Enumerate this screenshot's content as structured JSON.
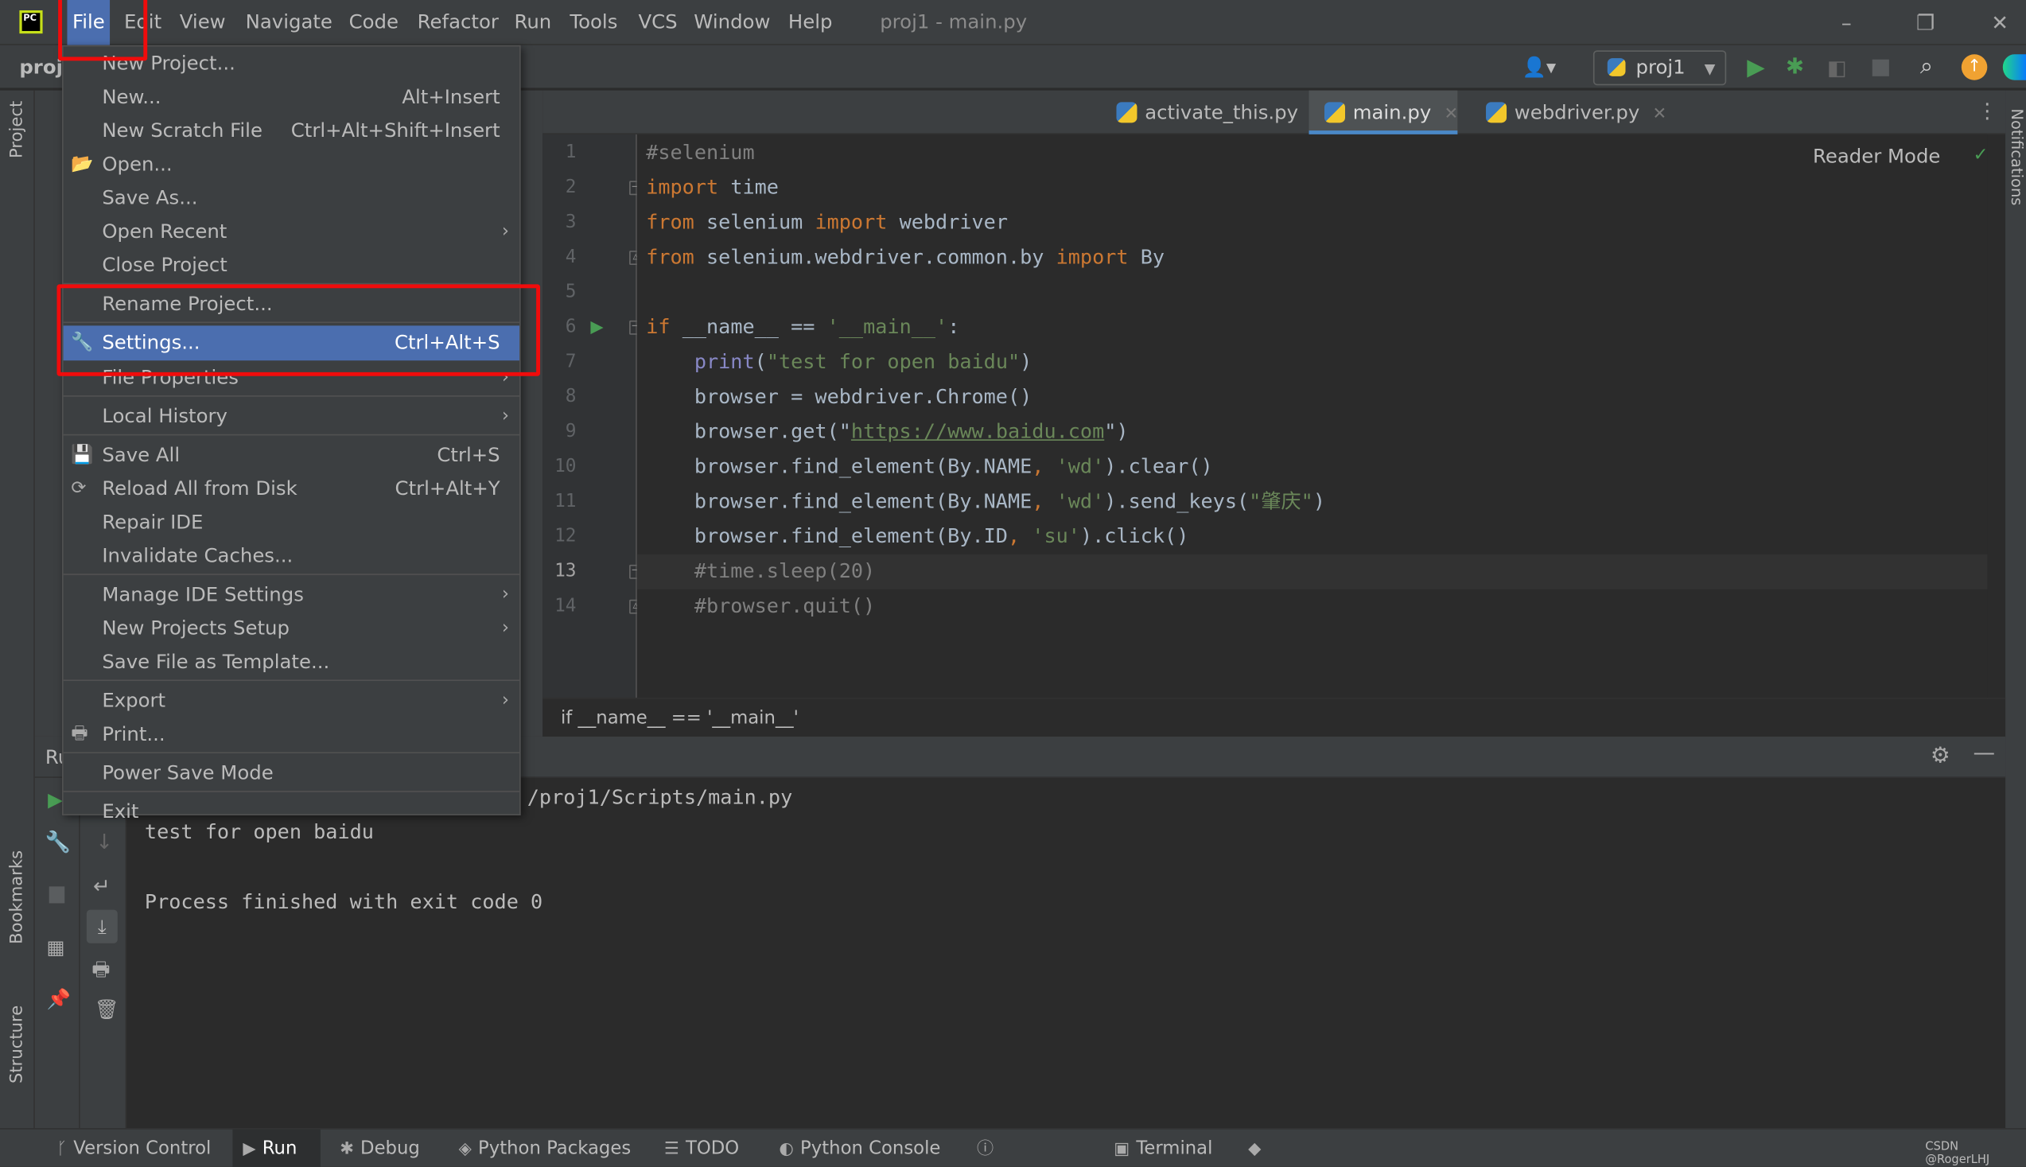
{
  "app": {
    "title": "proj1 - main.py",
    "logo": "PC"
  },
  "menubar": {
    "items": [
      "File",
      "Edit",
      "View",
      "Navigate",
      "Code",
      "Refactor",
      "Run",
      "Tools",
      "VCS",
      "Window",
      "Help"
    ],
    "active": "File"
  },
  "window_controls": {
    "minimize": "–",
    "restore": "❐",
    "close": "✕"
  },
  "toolbar": {
    "project_label": "proj",
    "run_config": "proj1"
  },
  "left_stripe": {
    "project": "Project",
    "bookmarks": "Bookmarks",
    "structure": "Structure"
  },
  "right_stripe": {
    "notifications": "Notifications"
  },
  "tabs": [
    {
      "label": "activate_this.py",
      "active": false
    },
    {
      "label": "main.py",
      "active": true
    },
    {
      "label": "webdriver.py",
      "active": false
    }
  ],
  "editor": {
    "reader_mode": "Reader Mode",
    "current_line": 13,
    "lines": [
      [
        [
          "#selenium",
          "cm"
        ]
      ],
      [
        [
          "import",
          "kw"
        ],
        [
          " time",
          ""
        ]
      ],
      [
        [
          "from",
          "kw"
        ],
        [
          " selenium ",
          ""
        ],
        [
          "import",
          "kw"
        ],
        [
          " webdriver",
          ""
        ]
      ],
      [
        [
          "from",
          "kw"
        ],
        [
          " selenium.webdriver.common.by ",
          ""
        ],
        [
          "import",
          "kw"
        ],
        [
          " By",
          ""
        ]
      ],
      [],
      [
        [
          "if",
          "kw"
        ],
        [
          " __name__ == ",
          ""
        ],
        [
          "'__main__'",
          "st"
        ],
        [
          ":",
          ""
        ]
      ],
      [
        [
          "    ",
          ""
        ],
        [
          "print",
          "bi"
        ],
        [
          "(",
          ""
        ],
        [
          "\"test for open baidu\"",
          "st"
        ],
        [
          ")",
          ""
        ]
      ],
      [
        [
          "    browser = webdriver.Chrome()",
          ""
        ]
      ],
      [
        [
          "    browser.get(",
          ""
        ],
        [
          "\"",
          ""
        ],
        [
          "https://www.baidu.com",
          "url"
        ],
        [
          "\"",
          ""
        ],
        [
          ")",
          ""
        ]
      ],
      [
        [
          "    browser.find_element(By.NAME",
          ""
        ],
        [
          ", ",
          "kw"
        ],
        [
          "'wd'",
          "st"
        ],
        [
          ").clear()",
          ""
        ]
      ],
      [
        [
          "    browser.find_element(By.NAME",
          ""
        ],
        [
          ", ",
          "kw"
        ],
        [
          "'wd'",
          "st"
        ],
        [
          ").send_keys(",
          ""
        ],
        [
          "\"肇庆\"",
          "st"
        ],
        [
          ")",
          ""
        ]
      ],
      [
        [
          "    browser.find_element(By.ID",
          ""
        ],
        [
          ", ",
          "kw"
        ],
        [
          "'su'",
          "st"
        ],
        [
          ").click()",
          ""
        ]
      ],
      [
        [
          "    ",
          ""
        ],
        [
          "#time.sleep(20)",
          "cm"
        ]
      ],
      [
        [
          "    ",
          ""
        ],
        [
          "#browser.quit()",
          "cm"
        ]
      ]
    ]
  },
  "breadcrumb": "if __name__ == '__main__'",
  "run_panel": {
    "title": "Ru",
    "output": [
      "/proj1/Scripts/main.py",
      "test for open baidu",
      "",
      "Process finished with exit code 0"
    ]
  },
  "file_menu": {
    "items": [
      {
        "label": "New Project...",
        "shortcut": ""
      },
      {
        "label": "New...",
        "shortcut": "Alt+Insert"
      },
      {
        "label": "New Scratch File",
        "shortcut": "Ctrl+Alt+Shift+Insert"
      },
      {
        "label": "Open...",
        "shortcut": "",
        "icon": "folder-icon"
      },
      {
        "label": "Save As...",
        "shortcut": ""
      },
      {
        "label": "Open Recent",
        "shortcut": "",
        "submenu": true
      },
      {
        "label": "Close Project",
        "shortcut": "",
        "sep_after": true
      },
      {
        "label": "Rename Project...",
        "shortcut": "",
        "sep_after": true
      },
      {
        "label": "Settings...",
        "shortcut": "Ctrl+Alt+S",
        "icon": "wrench-icon",
        "selected": true
      },
      {
        "label": "File Properties",
        "shortcut": "",
        "submenu": true,
        "sep_after": true
      },
      {
        "label": "Local History",
        "shortcut": "",
        "submenu": true,
        "sep_after": true
      },
      {
        "label": "Save All",
        "shortcut": "Ctrl+S",
        "icon": "save-icon"
      },
      {
        "label": "Reload All from Disk",
        "shortcut": "Ctrl+Alt+Y",
        "icon": "reload-icon"
      },
      {
        "label": "Repair IDE",
        "shortcut": ""
      },
      {
        "label": "Invalidate Caches...",
        "shortcut": "",
        "sep_after": true
      },
      {
        "label": "Manage IDE Settings",
        "shortcut": "",
        "submenu": true
      },
      {
        "label": "New Projects Setup",
        "shortcut": "",
        "submenu": true
      },
      {
        "label": "Save File as Template...",
        "shortcut": "",
        "sep_after": true
      },
      {
        "label": "Export",
        "shortcut": "",
        "submenu": true
      },
      {
        "label": "Print...",
        "shortcut": "",
        "icon": "print-icon",
        "sep_after": true
      },
      {
        "label": "Power Save Mode",
        "shortcut": "",
        "sep_after": true
      },
      {
        "label": "Exit",
        "shortcut": ""
      }
    ]
  },
  "bottom_bar": {
    "items": [
      {
        "label": "Version Control",
        "icon": "branch-icon"
      },
      {
        "label": "Run",
        "icon": "run-icon",
        "active": true
      },
      {
        "label": "Debug",
        "icon": "bug-icon"
      },
      {
        "label": "Python Packages",
        "icon": "packages-icon"
      },
      {
        "label": "TODO",
        "icon": "list-icon"
      },
      {
        "label": "Python Console",
        "icon": "python-icon"
      },
      {
        "label": "Problems",
        "icon": "problems-icon"
      },
      {
        "label": "Terminal",
        "icon": "terminal-icon"
      },
      {
        "label": "Services",
        "icon": "services-icon"
      }
    ],
    "watermark": "CSDN @RogerLHJ"
  },
  "colors": {
    "highlight": "#4b6eaf",
    "annotation": "#f00c0c",
    "run_green": "#499c54",
    "accent": "#4a88c7"
  }
}
